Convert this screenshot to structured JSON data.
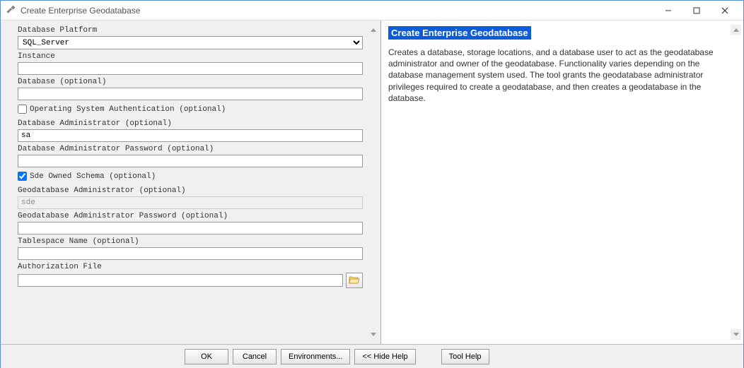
{
  "window": {
    "title": "Create Enterprise Geodatabase"
  },
  "fields": {
    "db_platform": {
      "label": "Database Platform",
      "value": "SQL_Server"
    },
    "instance": {
      "label": "Instance",
      "value": "",
      "required": true
    },
    "database": {
      "label": "Database (optional)",
      "value": "",
      "required": true
    },
    "os_auth": {
      "label": "Operating System Authentication (optional)",
      "checked": false
    },
    "db_admin": {
      "label": "Database Administrator (optional)",
      "value": "sa"
    },
    "db_admin_pw": {
      "label": "Database Administrator Password (optional)",
      "value": ""
    },
    "sde_schema": {
      "label": "Sde Owned Schema (optional)",
      "checked": true
    },
    "gdb_admin": {
      "label": "Geodatabase Administrator (optional)",
      "value": "sde",
      "disabled": true
    },
    "gdb_admin_pw": {
      "label": "Geodatabase Administrator Password (optional)",
      "value": ""
    },
    "tablespace": {
      "label": "Tablespace Name (optional)",
      "value": ""
    },
    "auth_file": {
      "label": "Authorization File",
      "value": "",
      "required": true
    }
  },
  "help": {
    "title": "Create Enterprise Geodatabase",
    "body": "Creates a database, storage locations, and a database user to act as the geodatabase administrator and owner of the geodatabase. Functionality varies depending on the database management system used. The tool grants the geodatabase administrator privileges required to create a geodatabase, and then creates a geodatabase in the database."
  },
  "buttons": {
    "ok": "OK",
    "cancel": "Cancel",
    "environments": "Environments...",
    "hide_help": "<< Hide Help",
    "tool_help": "Tool Help"
  }
}
